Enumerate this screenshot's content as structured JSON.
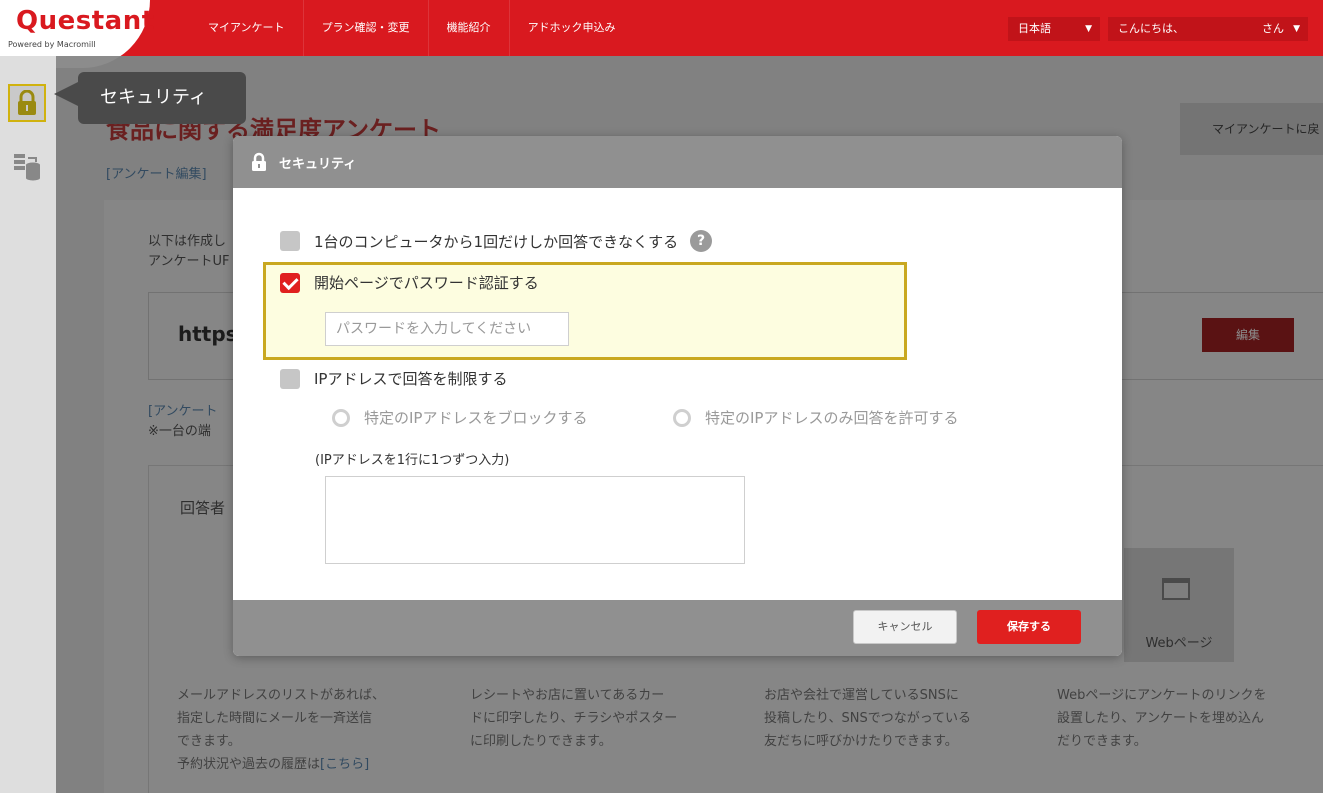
{
  "header": {
    "logo": "Questant",
    "logo_sub": "Powered by Macromill",
    "nav": [
      "マイアンケート",
      "プラン確認・変更",
      "機能紹介",
      "アドホック申込み"
    ],
    "language": "日本語",
    "greeting": "こんにちは、",
    "greeting_suffix": "さん"
  },
  "sidebar": {
    "tooltip": "セキュリティ"
  },
  "page": {
    "title": "食品に関する満足度アンケート",
    "edit_link": "[アンケート編集]",
    "back_button": "マイアンケートに戻",
    "intro_line1": "以下は作成し",
    "intro_line2": "アンケートUF",
    "url": "https",
    "edit_button": "編集",
    "note_line1": "[アンケート",
    "note_line2": "※一台の端",
    "respondents_label": "回答者",
    "web_tile_label": "Webページ",
    "desc": [
      {
        "lines": [
          "メールアドレスのリストがあれば、",
          "指定した時間にメールを一斉送信",
          "できます。",
          "予約状況や過去の履歴は"
        ],
        "link": "[こちら]"
      },
      {
        "lines": [
          "レシートやお店に置いてあるカー",
          "ドに印字したり、チラシやポスター",
          "に印刷したりできます。"
        ]
      },
      {
        "lines": [
          "お店や会社で運営しているSNSに",
          "投稿したり、SNSでつながっている",
          "友だちに呼びかけたりできます。"
        ]
      },
      {
        "lines": [
          "Webページにアンケートのリンクを",
          "設置したり、アンケートを埋め込ん",
          "だりできます。"
        ]
      }
    ]
  },
  "modal": {
    "title": "セキュリティ",
    "options": {
      "one_per_computer": {
        "label": "1台のコンピュータから1回だけしか回答できなくする",
        "checked": false
      },
      "password": {
        "label": "開始ページでパスワード認証する",
        "checked": true,
        "placeholder": "パスワードを入力してください"
      },
      "ip_restrict": {
        "label": "IPアドレスで回答を制限する",
        "checked": false
      }
    },
    "radios": [
      "特定のIPアドレスをブロックする",
      "特定のIPアドレスのみ回答を許可する"
    ],
    "ip_hint": "(IPアドレスを1行に1つずつ入力)",
    "cancel": "キャンセル",
    "save": "保存する",
    "help_glyph": "?"
  },
  "colors": {
    "brand": "#d9191f",
    "save": "#e0201f",
    "highlight_border": "#c9a820"
  },
  "icons": [
    "lock-icon",
    "database-icon",
    "help-icon",
    "chevron-down-icon",
    "web-page-icon"
  ]
}
